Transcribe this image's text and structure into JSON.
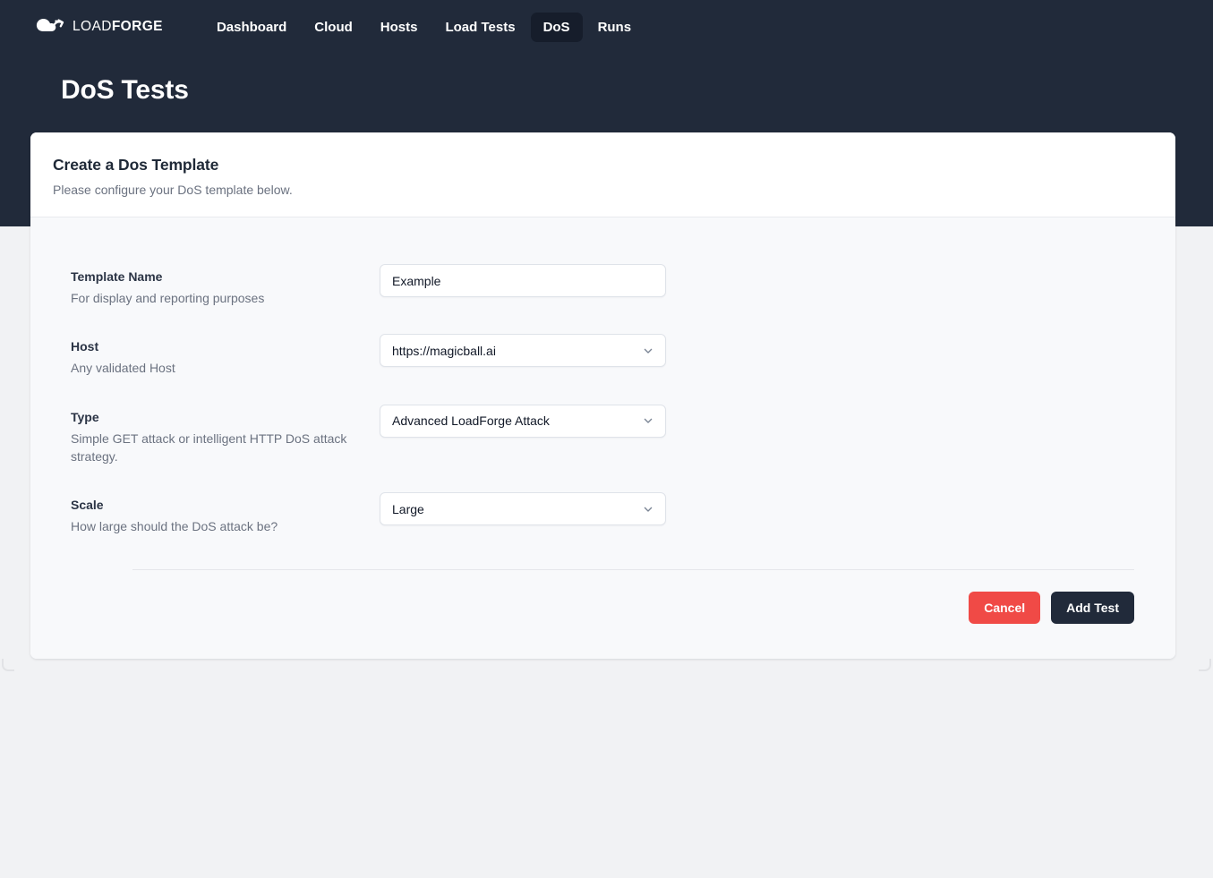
{
  "brand": {
    "name_light": "LOAD",
    "name_bold": "FORGE",
    "logo_icon": "cloud-arrow-icon"
  },
  "nav": {
    "items": [
      {
        "label": "Dashboard",
        "active": false
      },
      {
        "label": "Cloud",
        "active": false
      },
      {
        "label": "Hosts",
        "active": false
      },
      {
        "label": "Load Tests",
        "active": false
      },
      {
        "label": "DoS",
        "active": true
      },
      {
        "label": "Runs",
        "active": false
      }
    ]
  },
  "page": {
    "title": "DoS Tests"
  },
  "card": {
    "title": "Create a Dos Template",
    "subtitle": "Please configure your DoS template below."
  },
  "form": {
    "fields": [
      {
        "key": "template_name",
        "label": "Template Name",
        "help": "For display and reporting purposes",
        "control": "text",
        "value": "Example",
        "placeholder": ""
      },
      {
        "key": "host",
        "label": "Host",
        "help": "Any validated Host",
        "control": "select",
        "value": "https://magicball.ai"
      },
      {
        "key": "type",
        "label": "Type",
        "help": "Simple GET attack or intelligent HTTP DoS attack strategy.",
        "control": "select",
        "value": "Advanced LoadForge Attack"
      },
      {
        "key": "scale",
        "label": "Scale",
        "help": "How large should the DoS attack be?",
        "control": "select",
        "value": "Large"
      }
    ]
  },
  "actions": {
    "cancel_label": "Cancel",
    "submit_label": "Add Test"
  },
  "colors": {
    "dark_navy": "#212a3a",
    "nav_active": "#161d2b",
    "danger_red": "#f04a46",
    "body_bg": "#f1f2f4",
    "form_bg": "#f8f9fb"
  }
}
